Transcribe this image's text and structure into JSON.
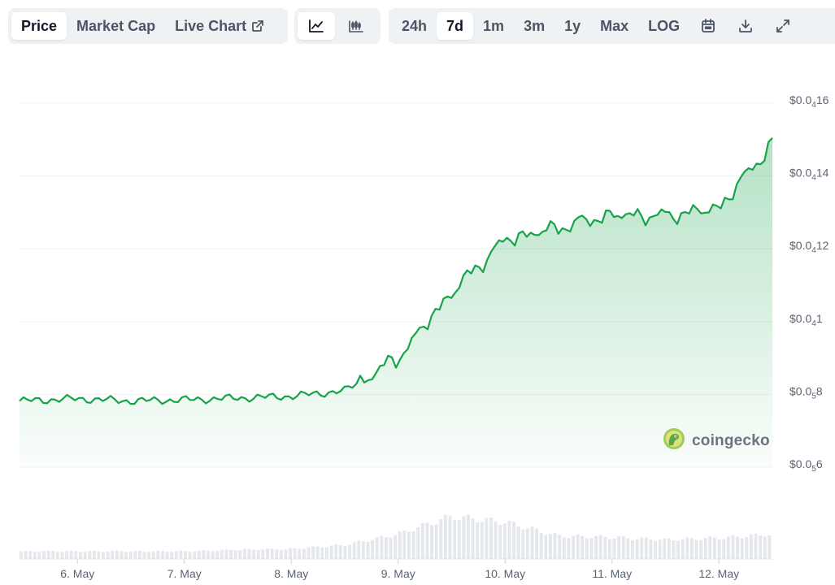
{
  "tabs": {
    "price": "Price",
    "market_cap": "Market Cap",
    "live_chart": "Live Chart"
  },
  "chart_type_icons": [
    "line-chart-icon",
    "candlestick-chart-icon"
  ],
  "ranges": [
    "24h",
    "7d",
    "1m",
    "3m",
    "1y",
    "Max",
    "LOG"
  ],
  "active_range": "7d",
  "tool_icons": [
    "calendar-icon",
    "download-icon",
    "expand-icon"
  ],
  "watermark": "coingecko",
  "colors": {
    "line": "#16a34a",
    "area": "#16a34a",
    "volume": "#e4e7eb",
    "grid": "#edf0f3"
  },
  "chart_data": {
    "type": "area",
    "series": [
      {
        "name": "",
        "x": [
          "2024-05-05T11:00",
          "2024-05-06T00:00",
          "2024-05-06T12:00",
          "2024-05-07T00:00",
          "2024-05-07T12:00",
          "2024-05-08T00:00",
          "2024-05-08T12:00",
          "2024-05-09T00:00",
          "2024-05-09T12:00",
          "2024-05-10T00:00",
          "2024-05-10T12:00",
          "2024-05-11T00:00",
          "2024-05-11T12:00",
          "2024-05-12T00:00",
          "2024-05-12T12:00"
        ],
        "values": [
          7.82,
          7.88,
          7.82,
          7.85,
          7.9,
          7.95,
          8.1,
          9.0,
          10.8,
          12.25,
          12.58,
          12.93,
          12.9,
          13.12,
          14.9
        ]
      }
    ],
    "y_unit_note": "$0.0₅8 = 0.000008; $0.0₄1 = 0.00001",
    "y_ticks": [
      {
        "value": 6e-06,
        "prefix": "$0.0",
        "sub": "5",
        "digits": "6"
      },
      {
        "value": 8e-06,
        "prefix": "$0.0",
        "sub": "5",
        "digits": "8"
      },
      {
        "value": 1e-05,
        "prefix": "$0.0",
        "sub": "4",
        "digits": "1"
      },
      {
        "value": 1.2e-05,
        "prefix": "$0.0",
        "sub": "4",
        "digits": "12"
      },
      {
        "value": 1.4e-05,
        "prefix": "$0.0",
        "sub": "4",
        "digits": "14"
      },
      {
        "value": 1.6e-05,
        "prefix": "$0.0",
        "sub": "4",
        "digits": "16"
      }
    ],
    "x_ticks": [
      "6. May",
      "7. May",
      "8. May",
      "9. May",
      "10. May",
      "11. May",
      "12. May"
    ],
    "ylim": [
      6e-06,
      1.6e-05
    ],
    "volume": [
      1,
      1,
      1,
      1,
      1.2,
      1.3,
      1.8,
      3.2,
      5.5,
      4.8,
      3.0,
      2.8,
      2.5,
      2.7,
      3.2
    ],
    "grid": true,
    "legend": "none"
  }
}
